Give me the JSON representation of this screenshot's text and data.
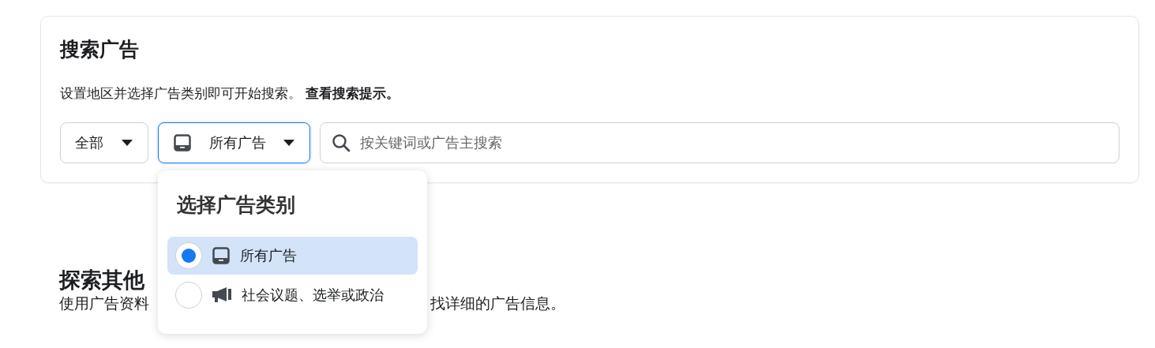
{
  "search_card": {
    "title": "搜索广告",
    "description": "设置地区并选择广告类别即可开始搜索。 **查看搜索提示。**",
    "region_select": {
      "label": "全部"
    },
    "category_select": {
      "label": "所有广告",
      "open": true
    },
    "search": {
      "placeholder": "按关键词或广告主搜索"
    }
  },
  "category_menu": {
    "title": "选择广告类别",
    "options": [
      {
        "kind": "tablet",
        "label": "所有广告",
        "selected": true
      },
      {
        "kind": "megaphone",
        "label": "社会议题、选举或政治",
        "selected": false
      }
    ]
  },
  "explore": {
    "title": "探索其他",
    "description_start": "使用广告资料",
    "description_end": "找详细的广告信息。"
  }
}
